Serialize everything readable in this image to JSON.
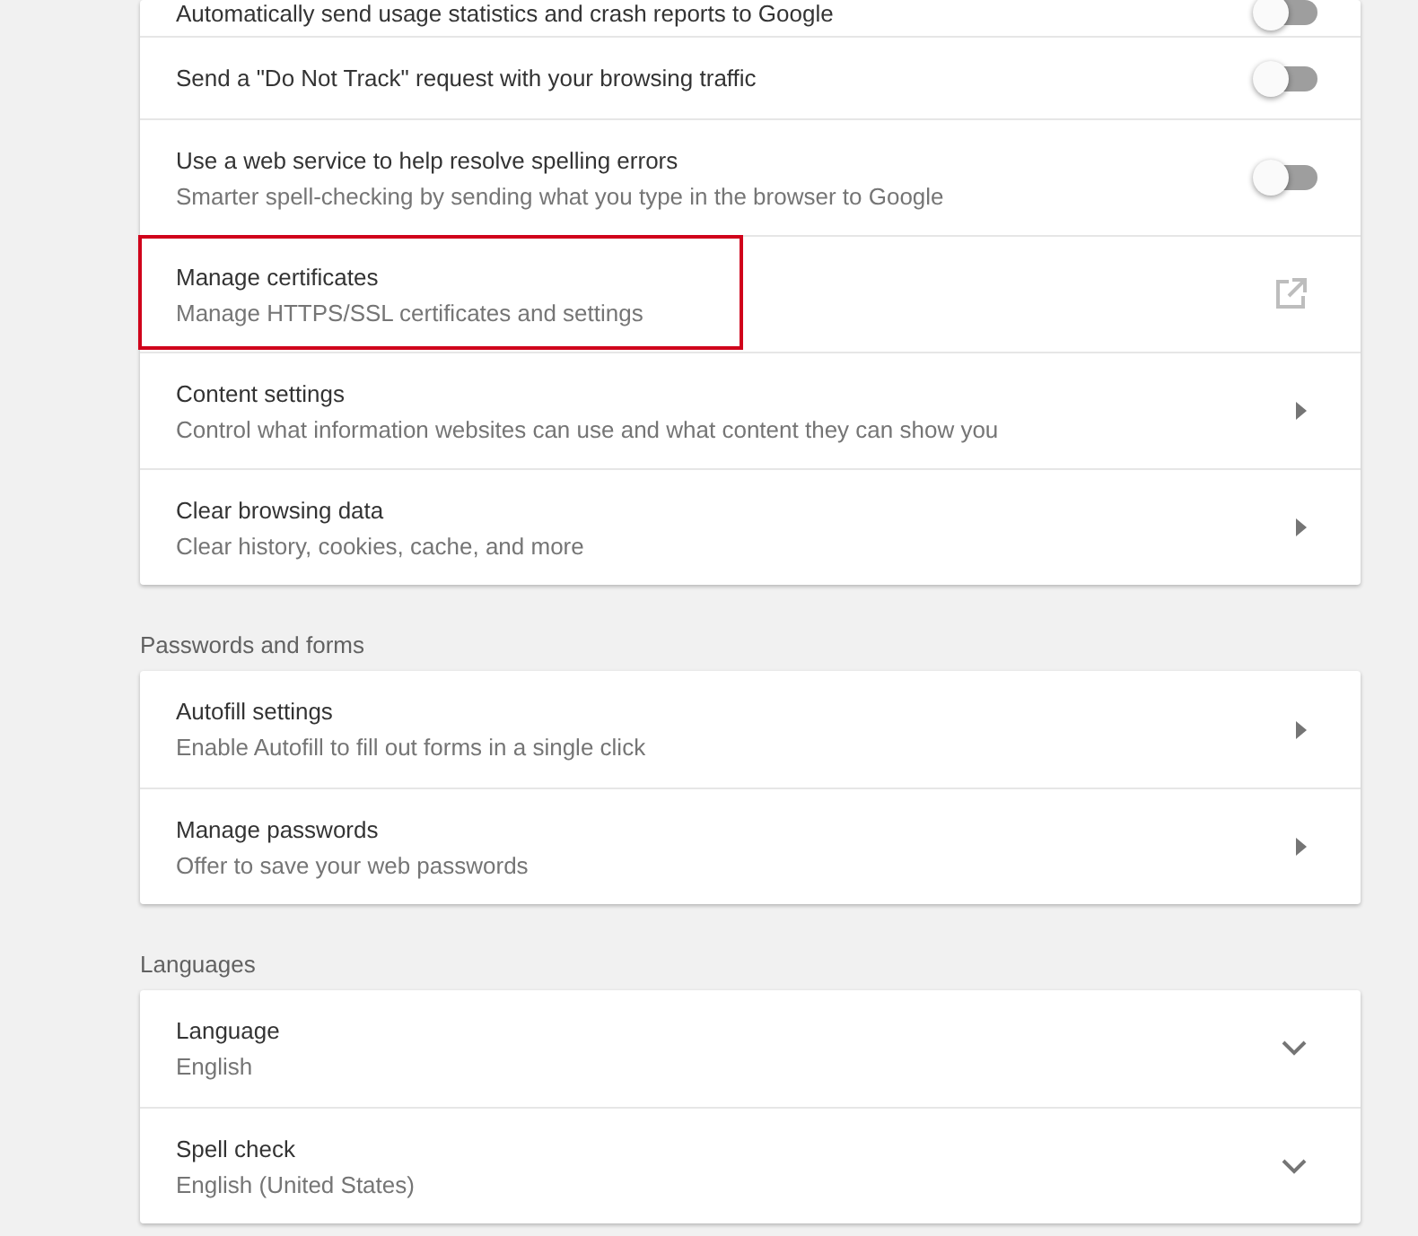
{
  "sections": [
    {
      "items": [
        {
          "title": "Automatically send usage statistics and crash reports to Google",
          "kind": "toggle",
          "on": false
        },
        {
          "title": "Send a \"Do Not Track\" request with your browsing traffic",
          "kind": "toggle",
          "on": false
        },
        {
          "title": "Use a web service to help resolve spelling errors",
          "subtitle": "Smarter spell-checking by sending what you type in the browser to Google",
          "kind": "toggle",
          "on": false
        },
        {
          "title": "Manage certificates",
          "subtitle": "Manage HTTPS/SSL certificates and settings",
          "kind": "external",
          "highlighted": true
        },
        {
          "title": "Content settings",
          "subtitle": "Control what information websites can use and what content they can show you",
          "kind": "arrow"
        },
        {
          "title": "Clear browsing data",
          "subtitle": "Clear history, cookies, cache, and more",
          "kind": "arrow"
        }
      ]
    },
    {
      "heading": "Passwords and forms",
      "items": [
        {
          "title": "Autofill settings",
          "subtitle": "Enable Autofill to fill out forms in a single click",
          "kind": "arrow"
        },
        {
          "title": "Manage passwords",
          "subtitle": "Offer to save your web passwords",
          "kind": "arrow"
        }
      ]
    },
    {
      "heading": "Languages",
      "items": [
        {
          "title": "Language",
          "subtitle": "English",
          "kind": "expand"
        },
        {
          "title": "Spell check",
          "subtitle": "English (United States)",
          "kind": "expand"
        }
      ]
    }
  ]
}
